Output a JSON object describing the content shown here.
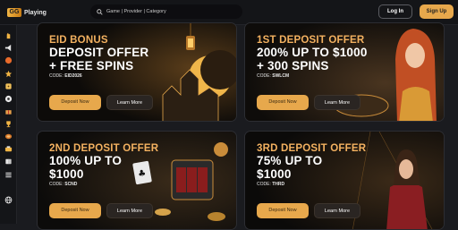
{
  "header": {
    "logo_mark": "GG",
    "logo_text": "Playing",
    "search_placeholder": "Game | Provider | Category",
    "login_label": "Log In",
    "signup_label": "Sign Up"
  },
  "sidebar": {
    "items": [
      {
        "icon": "hand-icon"
      },
      {
        "icon": "megaphone-icon"
      },
      {
        "icon": "crown-icon"
      },
      {
        "icon": "star-icon"
      },
      {
        "icon": "dice-icon"
      },
      {
        "icon": "ball-icon"
      },
      {
        "icon": "gift-icon"
      },
      {
        "icon": "trophy-icon"
      },
      {
        "icon": "card-icon"
      },
      {
        "icon": "chip-icon"
      },
      {
        "icon": "cards-icon"
      },
      {
        "icon": "menu-icon"
      },
      {
        "icon": "globe-icon"
      }
    ]
  },
  "promos": [
    {
      "title": "EID BONUS",
      "line1": "DEPOSIT OFFER",
      "line2": "+ FREE SPINS",
      "code_label": "CODE:",
      "code": "EID2026",
      "deposit_label": "Deposit Now",
      "more_label": "Learn More"
    },
    {
      "title": "1ST DEPOSIT OFFER",
      "line1": "200% UP TO $1000",
      "line2": "+ 300 SPINS",
      "code_label": "CODE:",
      "code": "SWLCM",
      "deposit_label": "Deposit Now",
      "more_label": "Learn More"
    },
    {
      "title": "2ND DEPOSIT OFFER",
      "line1": "100% UP TO",
      "line2": "$1000",
      "code_label": "CODE:",
      "code": "SCND",
      "deposit_label": "Deposit Now",
      "more_label": "Learn More"
    },
    {
      "title": "3RD DEPOSIT OFFER",
      "line1": "75% UP TO",
      "line2": "$1000",
      "code_label": "CODE:",
      "code": "THRD",
      "deposit_label": "Deposit Now",
      "more_label": "Learn More"
    }
  ],
  "colors": {
    "accent": "#e7a84c",
    "title_orange": "#f3b160",
    "background": "#1a1b1f"
  }
}
